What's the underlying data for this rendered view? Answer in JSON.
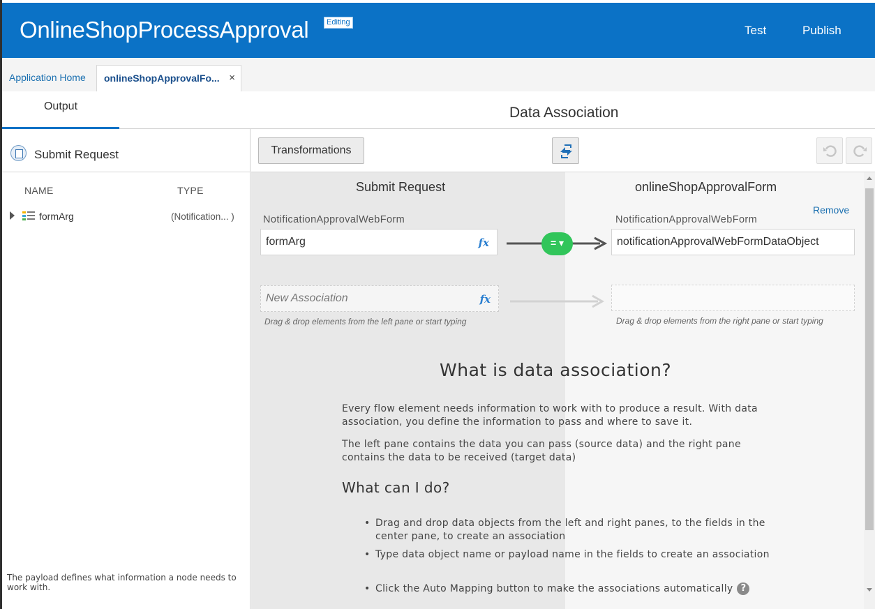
{
  "app": {
    "title": "OnlineShopProcessApproval",
    "badge": "Editing"
  },
  "header": {
    "test_label": "Test",
    "publish_label": "Publish"
  },
  "tabs": {
    "home_label": "Application Home",
    "active_label": "onlineShopApprovalFo...",
    "close_glyph": "×"
  },
  "subheader": {
    "output_tab": "Output",
    "title": "Data Association"
  },
  "left_pane": {
    "title": "Submit Request",
    "col_name": "NAME",
    "col_type": "TYPE",
    "items": [
      {
        "name": "formArg",
        "type": "(Notification... )"
      }
    ],
    "footer": "The payload defines what information a node needs to work with."
  },
  "toolbar": {
    "transformations_label": "Transformations"
  },
  "mapping": {
    "source_title": "Submit Request",
    "target_title": "onlineShopApprovalForm",
    "remove_label": "Remove",
    "source_type": "NotificationApprovalWebForm",
    "target_type": "NotificationApprovalWebForm",
    "source_value": "formArg",
    "target_value": "notificationApprovalWebFormDataObject",
    "operator": "= ▾",
    "fx_label": "fx",
    "new_placeholder": "New Association",
    "hint_left": "Drag & drop elements from the left pane or start typing",
    "hint_right": "Drag & drop elements from the right pane or start typing"
  },
  "help": {
    "title": "What is data association?",
    "p1": "Every flow element needs information to work with to produce a result. With data association, you define the information to pass and where to save it.",
    "p2": "The left pane contains the data you can pass (source data) and the right pane contains the data to be received (target data)",
    "subtitle": "What can I do?",
    "bullets": [
      "Drag and drop data objects from the left and right panes, to the fields in the center pane, to create an association",
      "Type data object name or payload name in the fields to create an association",
      "Click the Auto Mapping button to make the associations automatically"
    ],
    "help_glyph": "?"
  },
  "colors": {
    "brand": "#0b72c6",
    "operator": "#31c55a",
    "link": "#1a6fb0"
  },
  "icons": {
    "left_pane_title": "document-icon",
    "tree_item": "structure-icon",
    "auto_mapping": "auto-mapping-icon",
    "undo": "undo-icon",
    "redo": "redo-icon"
  }
}
